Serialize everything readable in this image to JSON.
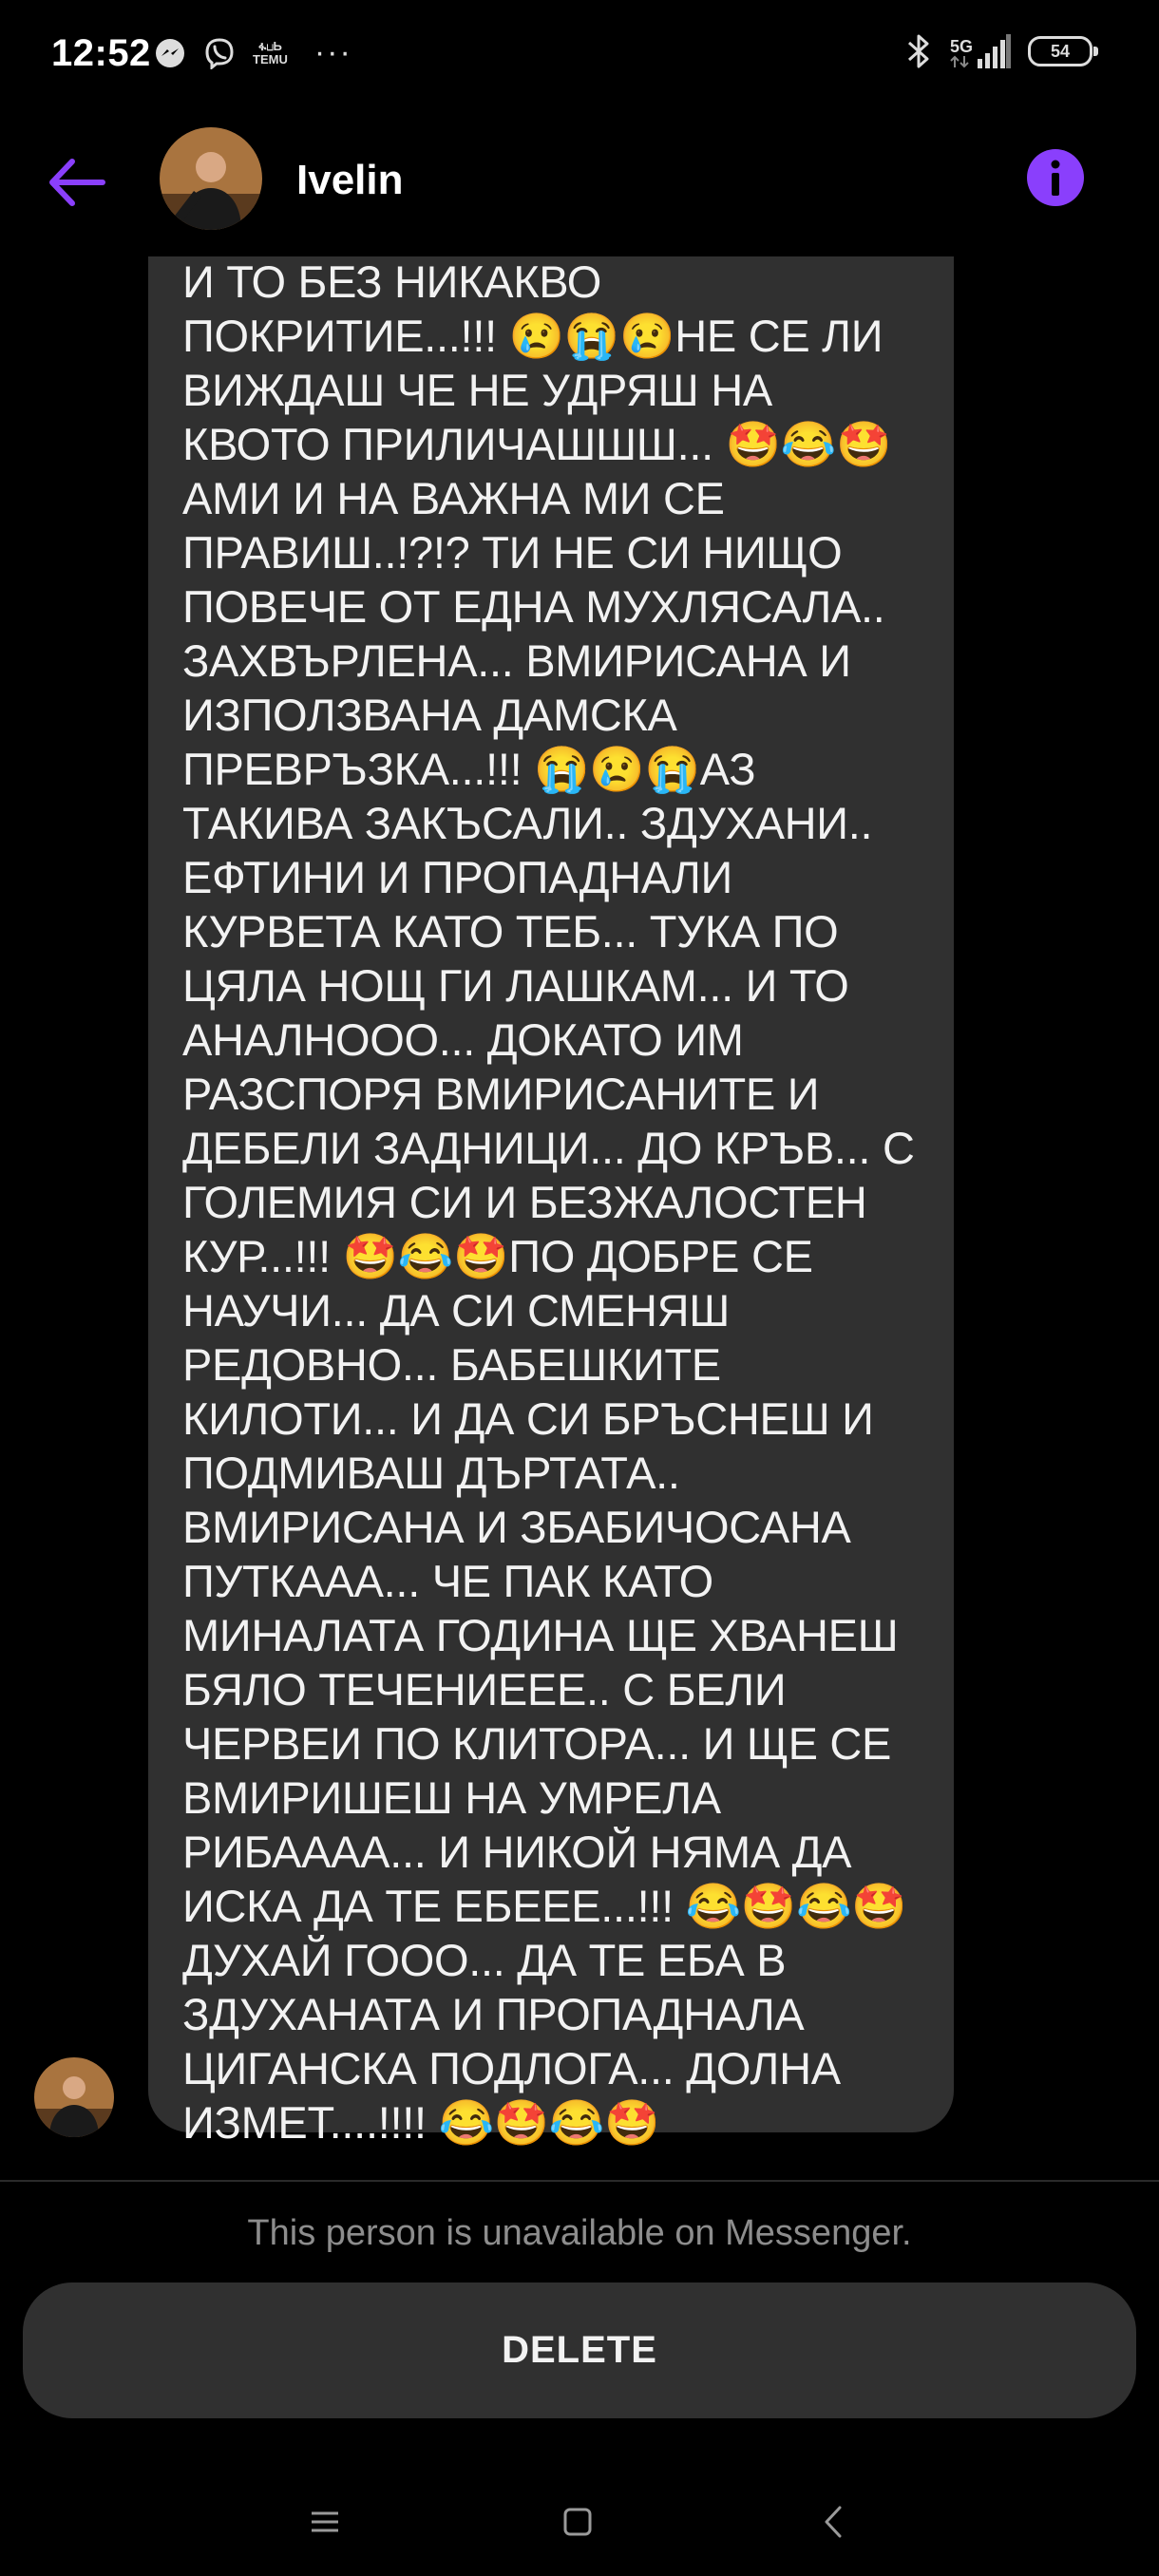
{
  "status_bar": {
    "time": "12:52",
    "left_icons": [
      "messenger-icon",
      "viber-icon",
      "temu-icon",
      "more-dots-icon"
    ],
    "temu_label_top": "ፋ⊔Ь",
    "temu_label_bottom": "TEMU",
    "more": "···",
    "network": "5G",
    "battery": "54"
  },
  "header": {
    "contact_name": "Ivelin",
    "accent_color": "#8a3ffc"
  },
  "message": {
    "text": "И ТО БЕЗ НИКАКВО\nПОКРИТИЕ...!!! 😢😭😢НЕ СЕ ЛИ\nВИЖДАШ ЧЕ НЕ УДРЯШ НА\nКВОТО ПРИЛИЧАШШШ... 🤩😂🤩\nАМИ И НА ВАЖНА МИ СЕ\nПРАВИШ..!?!? ТИ НЕ СИ НИЩО\nПОВЕЧЕ ОТ ЕДНА МУХЛЯСАЛА..\nЗАХВЪРЛЕНА... ВМИРИСАНА И\nИЗПОЛЗВАНА ДАМСКА\nПРЕВРЪЗКА...!!! 😭😢😭АЗ\nТАКИВА ЗАКЪСАЛИ.. ЗДУХАНИ..\nЕФТИНИ И ПРОПАДНАЛИ\nКУРВЕТА КАТО ТЕБ... ТУКА ПО\nЦЯЛА НОЩ ГИ ЛАШКАМ... И ТО\nАНАЛНООО... ДОКАТО ИМ\nРАЗСПОРЯ ВМИРИСАНИТЕ И\nДЕБЕЛИ ЗАДНИЦИ... ДО КРЪВ... С\nГОЛЕМИЯ СИ И БЕЗЖАЛОСТЕН\nКУР...!!! 🤩😂🤩ПО ДОБРЕ СЕ\nНАУЧИ... ДА СИ СМЕНЯШ\nРЕДОВНО... БАБЕШКИТЕ\nКИЛОТИ... И ДА СИ БРЪСНЕШ И\nПОДМИВАШ ДЪРТАТА..\nВМИРИСАНА И ЗБАБИЧОСАНА\nПУТКААА... ЧЕ ПАК КАТО\nМИНАЛАТА ГОДИНА ЩЕ ХВАНЕШ\nБЯЛО ТЕЧЕНИЕЕЕ.. С  БЕЛИ\nЧЕРВЕИ ПО КЛИТОРА... И ЩЕ СЕ\nВМИРИШЕШ НА УМРЕЛА\nРИБАААА... И НИКОЙ НЯМА ДА\nИСКА ДА ТЕ ЕБЕЕЕ...!!! 😂🤩😂🤩\nДУХАЙ ГООО... ДА ТЕ ЕБА В\nЗДУХАНАТА И ПРОПАДНАЛА\nЦИГАНСКА ПОДЛОГА... ДОЛНА\nИЗМЕТ....!!!! 😂🤩😂🤩"
  },
  "footer": {
    "unavailable_text": "This person is unavailable on Messenger.",
    "delete_label": "DELETE"
  },
  "navbar": {
    "icons": [
      "menu-icon",
      "home-square-icon",
      "back-chevron-icon"
    ]
  }
}
